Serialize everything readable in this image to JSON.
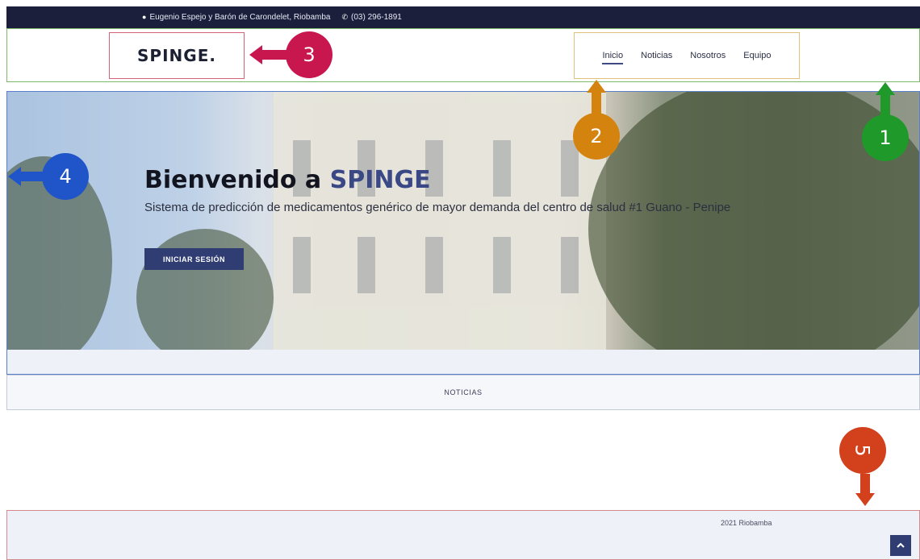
{
  "topbar": {
    "address_icon": "map-pin-icon",
    "address": "Eugenio Espejo y Barón de Carondelet, Riobamba",
    "phone_icon": "phone-icon",
    "phone": "(03) 296-1891"
  },
  "header": {
    "logo": "SPINGE.",
    "nav": [
      {
        "label": "Inicio",
        "active": true
      },
      {
        "label": "Noticias"
      },
      {
        "label": "Nosotros"
      },
      {
        "label": "Equipo"
      }
    ]
  },
  "hero": {
    "title_prefix": "Bienvenido a ",
    "title_highlight": "SPINGE",
    "subtitle": "Sistema de predicción de medicamentos genérico de mayor demanda del centro de salud #1 Guano - Penipe",
    "login_button": "INICIAR SESIÓN"
  },
  "news": {
    "tab_label": "NOTICIAS"
  },
  "footer": {
    "copyright": "2021 Riobamba",
    "back_to_top_icon": "chevron-up-icon"
  },
  "annotations": [
    {
      "number": "1",
      "color": "#1f9a2a"
    },
    {
      "number": "2",
      "color": "#d4840e"
    },
    {
      "number": "3",
      "color": "#c8164f"
    },
    {
      "number": "4",
      "color": "#1f55c9"
    },
    {
      "number": "5",
      "color": "#d2401c"
    }
  ]
}
